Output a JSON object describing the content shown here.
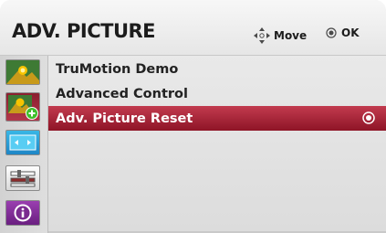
{
  "header": {
    "title": "ADV. PICTURE",
    "move_label": "Move",
    "ok_label": "OK"
  },
  "sidebar": {
    "items": [
      {
        "icon": "picture-icon"
      },
      {
        "icon": "picture-settings-icon"
      },
      {
        "icon": "screen-icon"
      },
      {
        "icon": "setup-icon"
      },
      {
        "icon": "info-icon"
      }
    ]
  },
  "menu": {
    "items": [
      {
        "label": "TruMotion Demo",
        "selected": false
      },
      {
        "label": "Advanced Control",
        "selected": false
      },
      {
        "label": "Adv. Picture Reset",
        "selected": true
      }
    ]
  },
  "colors": {
    "selection": "#a8253a",
    "accent_yellow": "#f2c200",
    "accent_green": "#3cbf2a",
    "info_purple": "#7a2b8f"
  }
}
